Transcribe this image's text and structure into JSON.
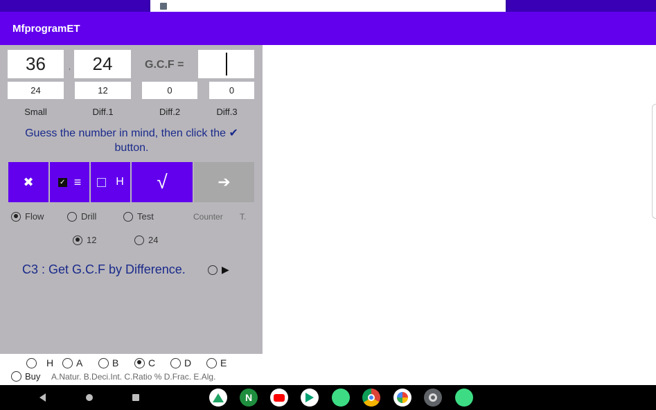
{
  "app": {
    "title": "MfprogramET"
  },
  "inputs": {
    "num1": "36",
    "separator": ",",
    "num2": "24",
    "gcf_label": "G.C.F =",
    "gcf_value": ""
  },
  "diffs": {
    "values": [
      "24",
      "12",
      "0",
      "0"
    ],
    "labels": [
      "Small",
      "Diff.1",
      "Diff.2",
      "Diff.3"
    ]
  },
  "hint": "Guess the number in mind, then click the ✔ button.",
  "toolbar": {
    "close_symbol": "✖",
    "menu_symbol": "≡",
    "h_label": "H",
    "check_symbol": "√",
    "next_symbol": "➔",
    "menu_checkbox_checked": true,
    "h_checkbox_checked": false
  },
  "mode_options": [
    {
      "label": "Flow",
      "selected": true
    },
    {
      "label": "Drill",
      "selected": false
    },
    {
      "label": "Test",
      "selected": false
    }
  ],
  "counter_label": "Counter",
  "t_label": "T.",
  "count_options": [
    {
      "label": "12",
      "selected": true
    },
    {
      "label": "24",
      "selected": false
    }
  ],
  "chapter": {
    "text": "C3 :  Get G.C.F by Difference.",
    "play_symbol": "▶"
  },
  "levels": [
    {
      "label": "H",
      "selected": false
    },
    {
      "label": "A",
      "selected": false
    },
    {
      "label": "B",
      "selected": false
    },
    {
      "label": "C",
      "selected": true
    },
    {
      "label": "D",
      "selected": false
    },
    {
      "label": "E",
      "selected": false
    }
  ],
  "buy_label": "Buy",
  "level_legend": "A.Natur. B.Deci.Int. C.Ratio % D.Frac. E.Alg.",
  "colors": {
    "accent": "#6200ee",
    "status_bar": "#3a00b6",
    "panel": "#b8b6bb",
    "text_blue": "#1a2a8a"
  },
  "nav_icons": [
    "back-icon",
    "home-icon",
    "recents-icon"
  ],
  "dock_icons": [
    "google-drive-icon",
    "n-app-icon",
    "youtube-icon",
    "play-store-icon",
    "android-app-icon",
    "chrome-icon",
    "photos-icon",
    "settings-icon",
    "android-app-icon-2"
  ]
}
